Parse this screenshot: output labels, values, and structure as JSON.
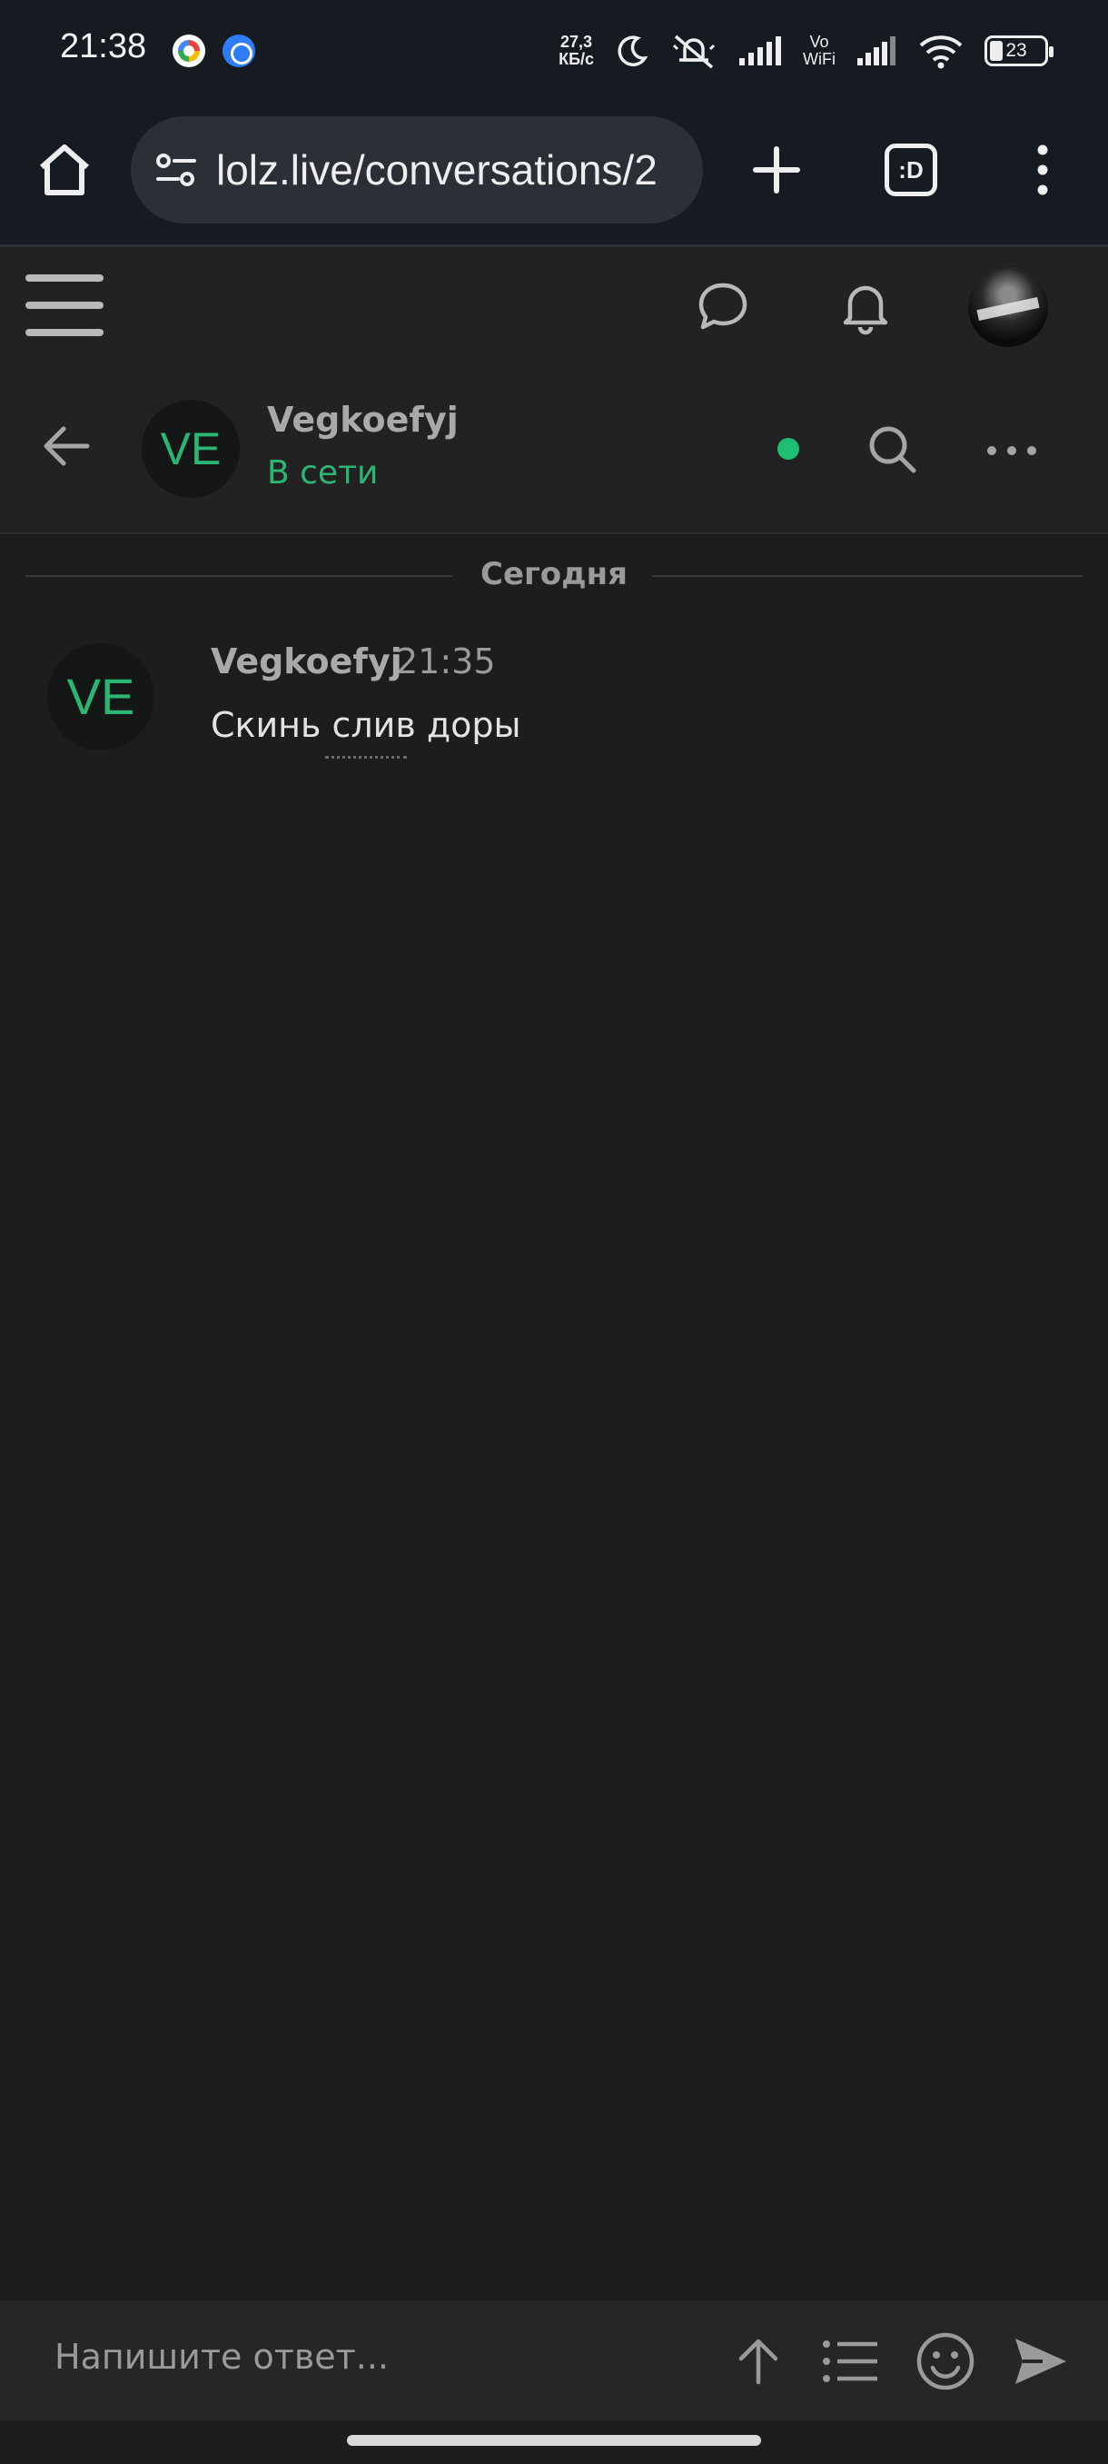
{
  "status_bar": {
    "time": "21:38",
    "speed_top": "27,3",
    "speed_bottom": "КБ/с",
    "vowifi_top": "Vo",
    "vowifi_bottom": "WiFi",
    "battery": "23"
  },
  "browser": {
    "url": "lolz.live/conversations/2",
    "tabs_label": ":D"
  },
  "conversation": {
    "name": "Vegkoefyj",
    "avatar_initials": "VE",
    "status": "В сети"
  },
  "day_separator": "Сегодня",
  "messages": [
    {
      "author": "Vegkoefyj",
      "initials": "VE",
      "time": "21:35",
      "text": "Скинь слив доры"
    }
  ],
  "composer": {
    "placeholder": "Напишите ответ..."
  },
  "colors": {
    "accent_green": "#2bb673",
    "online_dot": "#1fbf73",
    "background": "#1d1d1e"
  }
}
